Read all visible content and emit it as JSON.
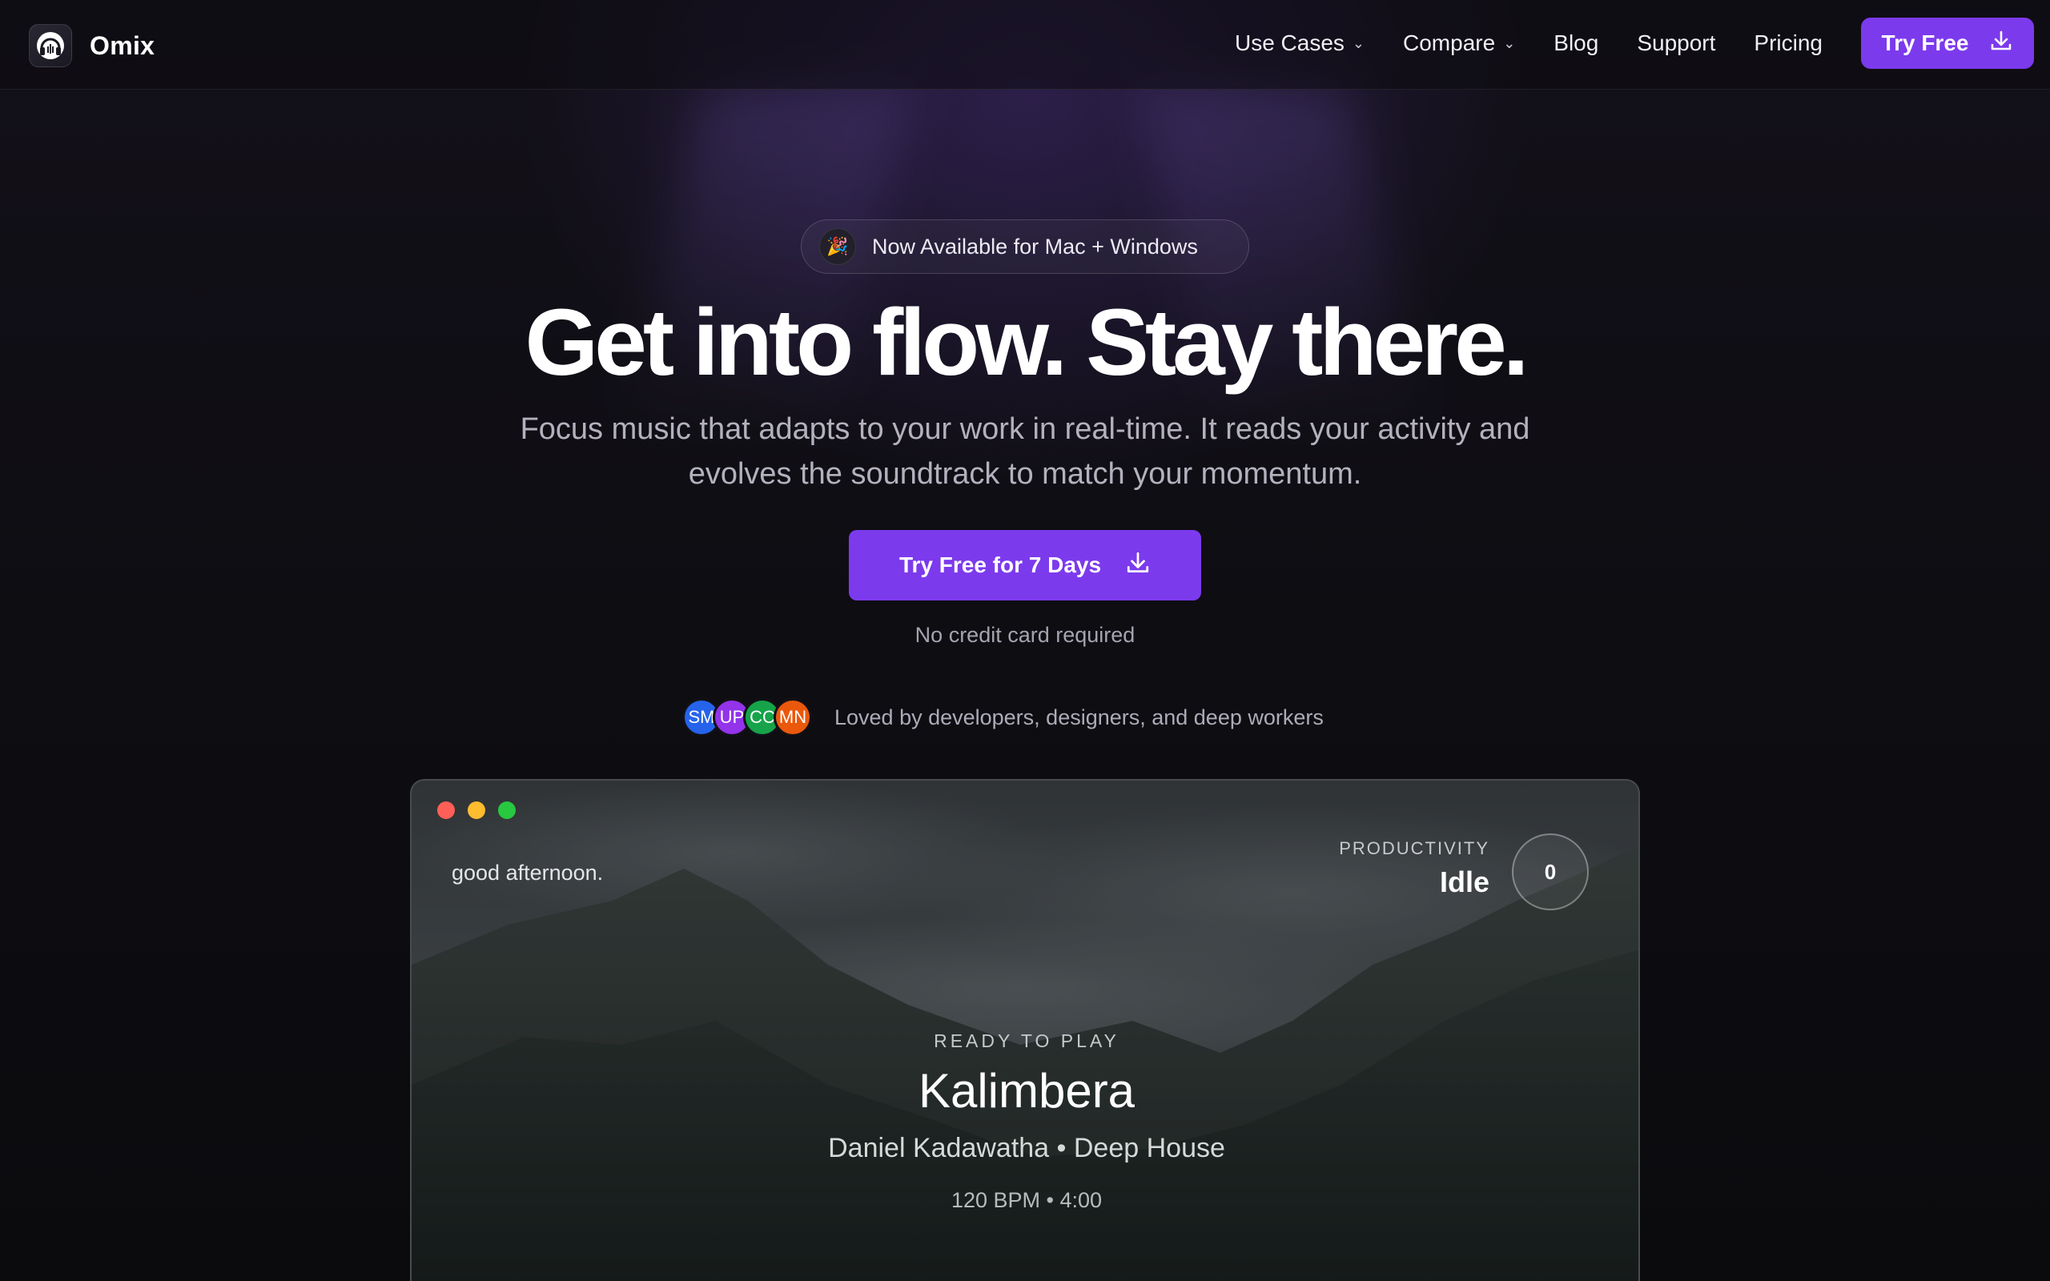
{
  "nav": {
    "brand": "Omix",
    "links": [
      {
        "label": "Use Cases",
        "dropdown": true
      },
      {
        "label": "Compare",
        "dropdown": true
      },
      {
        "label": "Blog",
        "dropdown": false
      },
      {
        "label": "Support",
        "dropdown": false
      },
      {
        "label": "Pricing",
        "dropdown": false
      }
    ],
    "cta_label": "Try Free",
    "cta_icon": "download-icon"
  },
  "hero": {
    "badge_icon": "party-popper-icon",
    "badge_text": "Now Available for Mac + Windows",
    "headline": "Get into flow. Stay there.",
    "subheadline_line1": "Focus music that adapts to your work in real-time. It reads your activity and",
    "subheadline_line2": "evolves the soundtrack to match your momentum.",
    "cta_label": "Try Free for 7 Days",
    "cta_note": "No credit card required",
    "social_proof_text": "Loved by developers, designers, and deep workers",
    "avatars": [
      {
        "initials": "SM",
        "color": "#2563eb"
      },
      {
        "initials": "UP",
        "color": "#9333ea"
      },
      {
        "initials": "CC",
        "color": "#16a34a"
      },
      {
        "initials": "MN",
        "color": "#ea580c"
      }
    ]
  },
  "app_window": {
    "greeting": "good afternoon.",
    "productivity_label": "PRODUCTIVITY",
    "productivity_value": "Idle",
    "productivity_score": "0",
    "status": "READY TO PLAY",
    "track_title": "Kalimbera",
    "track_artist_genre": "Daniel Kadawatha • Deep House",
    "track_meta": "120 BPM • 4:00"
  },
  "colors": {
    "accent": "#7c3aed",
    "background": "#0c0b10",
    "traffic_red": "#ff5f57",
    "traffic_yellow": "#febc2e",
    "traffic_green": "#28c840"
  }
}
